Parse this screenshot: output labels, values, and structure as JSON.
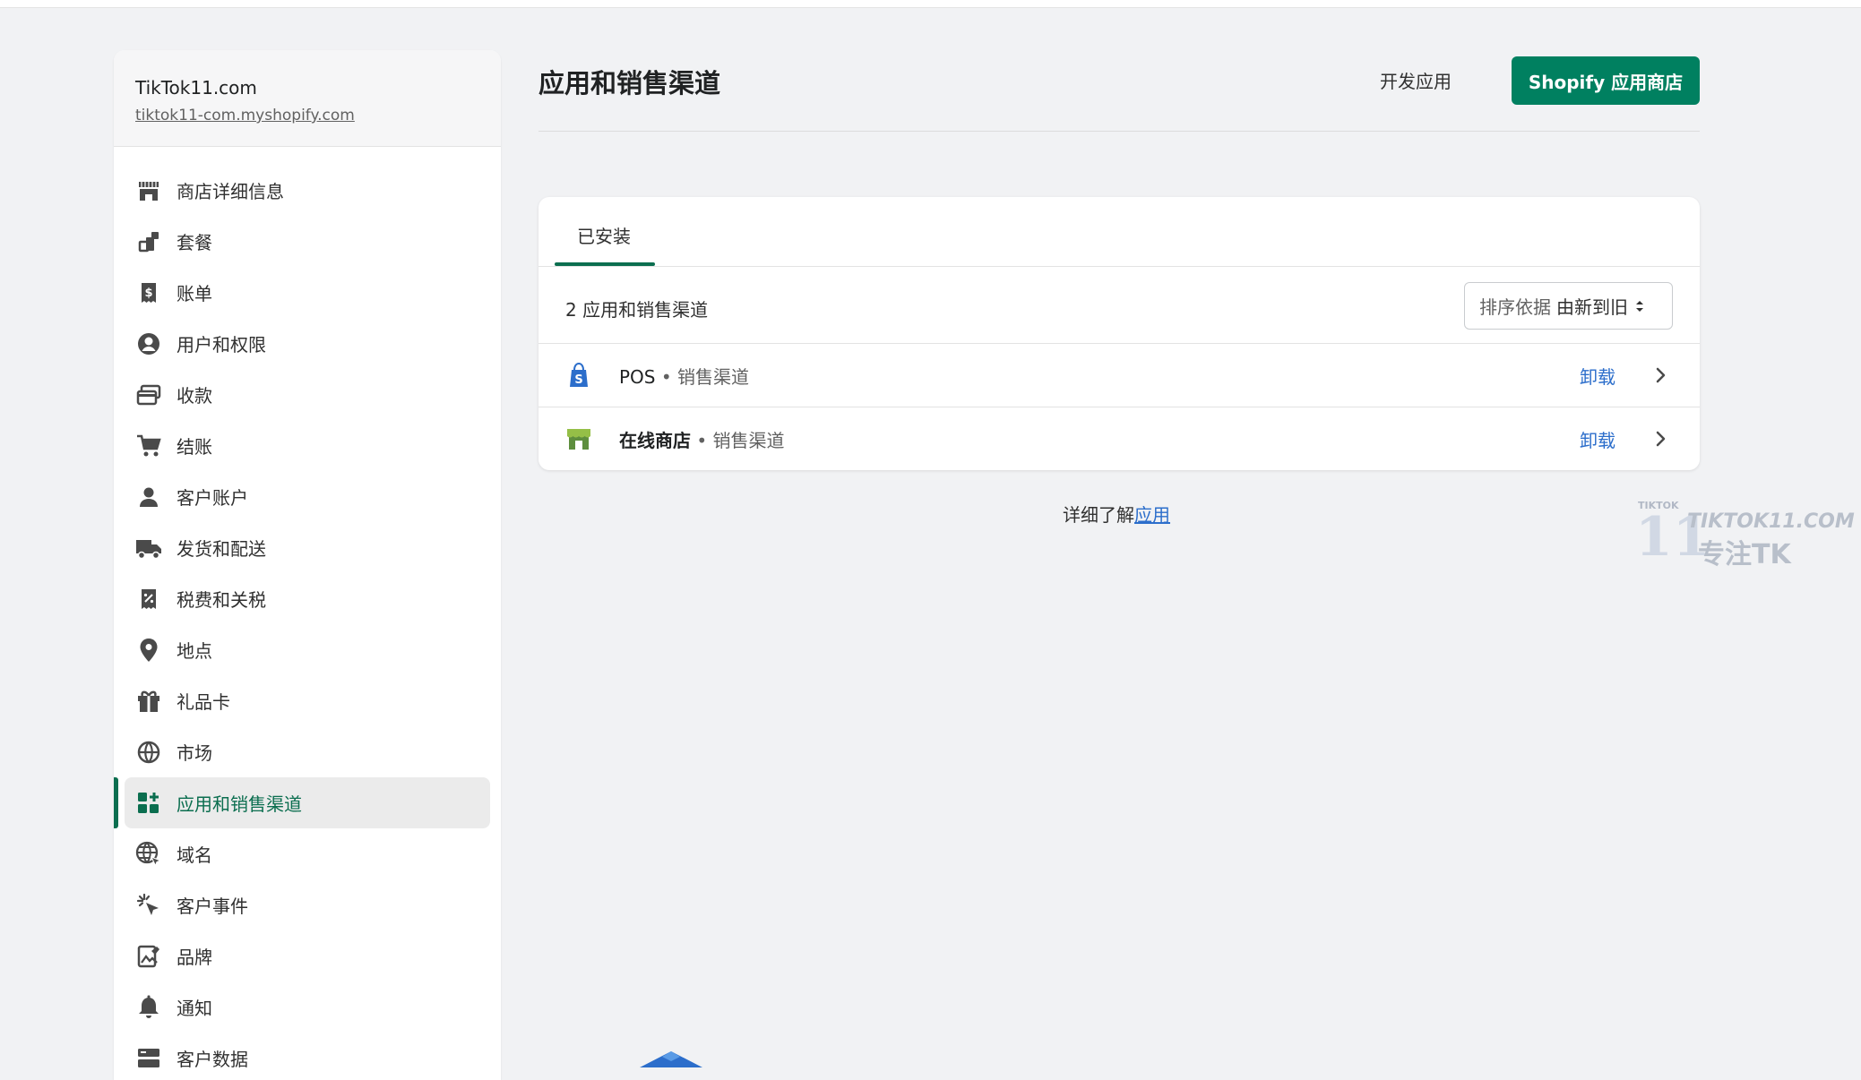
{
  "store": {
    "name": "TikTok11.com",
    "url": "tiktok11-com.myshopify.com"
  },
  "sidebar": {
    "items": [
      {
        "label": "商店详细信息",
        "icon": "store-icon"
      },
      {
        "label": "套餐",
        "icon": "plan-icon"
      },
      {
        "label": "账单",
        "icon": "billing-icon"
      },
      {
        "label": "用户和权限",
        "icon": "user-circle-icon"
      },
      {
        "label": "收款",
        "icon": "payments-icon"
      },
      {
        "label": "结账",
        "icon": "cart-icon"
      },
      {
        "label": "客户账户",
        "icon": "person-icon"
      },
      {
        "label": "发货和配送",
        "icon": "truck-icon"
      },
      {
        "label": "税费和关税",
        "icon": "tax-icon"
      },
      {
        "label": "地点",
        "icon": "location-icon"
      },
      {
        "label": "礼品卡",
        "icon": "gift-icon"
      },
      {
        "label": "市场",
        "icon": "globe-icon"
      },
      {
        "label": "应用和销售渠道",
        "icon": "apps-icon",
        "active": true
      },
      {
        "label": "域名",
        "icon": "domain-icon"
      },
      {
        "label": "客户事件",
        "icon": "click-icon"
      },
      {
        "label": "品牌",
        "icon": "brand-icon"
      },
      {
        "label": "通知",
        "icon": "bell-icon"
      },
      {
        "label": "客户数据",
        "icon": "data-icon"
      }
    ]
  },
  "header": {
    "title": "应用和销售渠道",
    "dev_apps": "开发应用",
    "app_store": "Shopify 应用商店"
  },
  "installed": {
    "tab": "已安装",
    "count_label": "2 应用和销售渠道",
    "sort_key": "排序依据",
    "sort_value": "由新到旧",
    "apps": [
      {
        "name": "POS",
        "sub": " • 销售渠道",
        "action": "卸载",
        "icon": "shopify-pos-icon"
      },
      {
        "name": "在线商店",
        "sub": " • 销售渠道",
        "action": "卸载",
        "icon": "online-store-icon"
      }
    ]
  },
  "learn_more": {
    "prefix": "详细了解",
    "link": "应用"
  },
  "watermark": {
    "top": "TIKTOK",
    "big": "11",
    "site": "TIKTOK11.COM",
    "slogan": "专注TK"
  },
  "colors": {
    "accent": "#008060",
    "active_text": "#0b6e4f",
    "link": "#2c6ecb"
  }
}
